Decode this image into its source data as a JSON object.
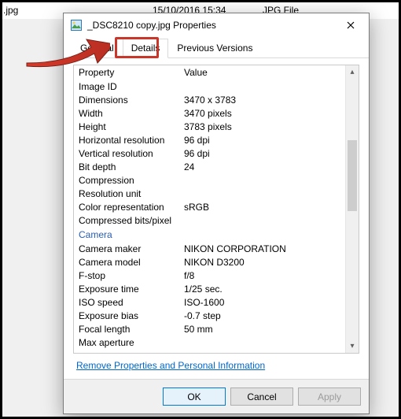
{
  "background": {
    "fileName": ".jpg",
    "date": "15/10/2016 15:34",
    "type": "JPG File"
  },
  "dialog": {
    "title": "_DSC8210 copy.jpg Properties",
    "tabs": [
      {
        "label": "General"
      },
      {
        "label": "Details"
      },
      {
        "label": "Previous Versions"
      }
    ],
    "headers": {
      "property": "Property",
      "value": "Value"
    },
    "rows": [
      {
        "prop": "Image ID",
        "val": ""
      },
      {
        "prop": "Dimensions",
        "val": "3470 x 3783"
      },
      {
        "prop": "Width",
        "val": "3470 pixels"
      },
      {
        "prop": "Height",
        "val": "3783 pixels"
      },
      {
        "prop": "Horizontal resolution",
        "val": "96 dpi"
      },
      {
        "prop": "Vertical resolution",
        "val": "96 dpi"
      },
      {
        "prop": "Bit depth",
        "val": "24"
      },
      {
        "prop": "Compression",
        "val": ""
      },
      {
        "prop": "Resolution unit",
        "val": ""
      },
      {
        "prop": "Color representation",
        "val": "sRGB"
      },
      {
        "prop": "Compressed bits/pixel",
        "val": ""
      }
    ],
    "sectionCamera": "Camera",
    "rows2": [
      {
        "prop": "Camera maker",
        "val": "NIKON CORPORATION"
      },
      {
        "prop": "Camera model",
        "val": "NIKON D3200"
      },
      {
        "prop": "F-stop",
        "val": "f/8"
      },
      {
        "prop": "Exposure time",
        "val": "1/25 sec."
      },
      {
        "prop": "ISO speed",
        "val": "ISO-1600"
      },
      {
        "prop": "Exposure bias",
        "val": "-0.7 step"
      },
      {
        "prop": "Focal length",
        "val": "50 mm"
      },
      {
        "prop": "Max aperture",
        "val": ""
      }
    ],
    "removeLink": "Remove Properties and Personal Information",
    "buttons": {
      "ok": "OK",
      "cancel": "Cancel",
      "apply": "Apply"
    }
  }
}
